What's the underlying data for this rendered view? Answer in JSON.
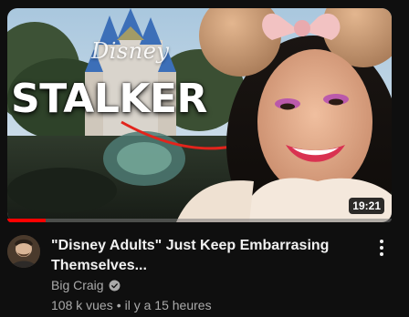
{
  "thumbnail": {
    "headline": "STALKER",
    "logo_text": "Disney",
    "duration": "19:21",
    "watch_progress_percent": 10
  },
  "video": {
    "title": "\"Disney Adults\" Just Keep Embarrasing Themselves...",
    "channel": "Big Craig",
    "views": "108 k vues",
    "separator": "•",
    "age": "il y a 15 heures"
  },
  "icons": {
    "verified": "verified-check-icon",
    "more": "more-vert-icon"
  },
  "colors": {
    "background": "#0f0f0f",
    "title": "#f1f1f1",
    "secondary_text": "#aaaaaa",
    "progress": "#ff0000"
  }
}
